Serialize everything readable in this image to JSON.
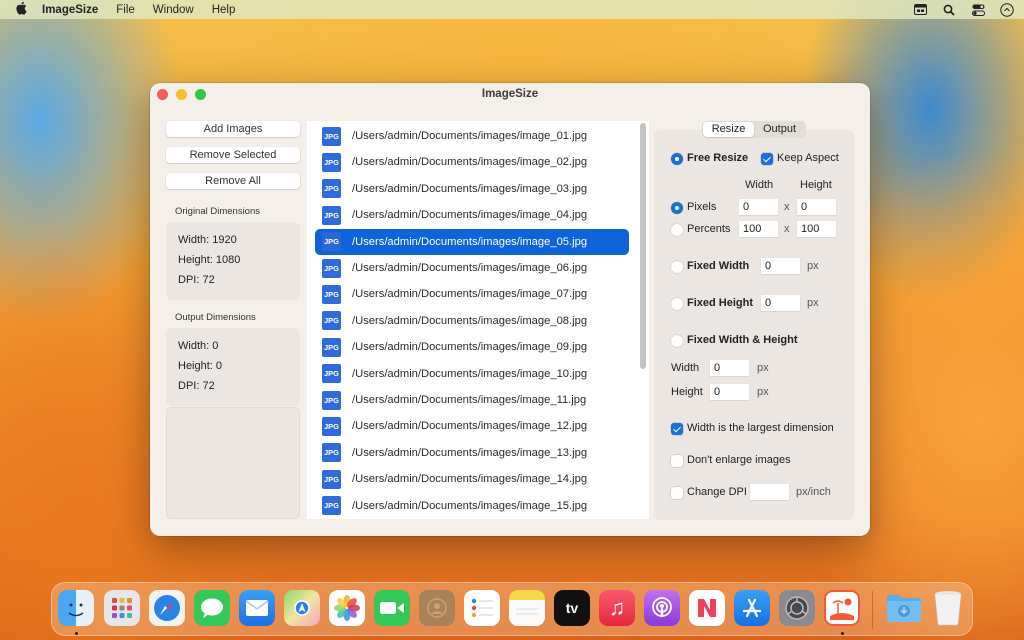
{
  "menubar": {
    "app_name": "ImageSize",
    "menus": [
      "File",
      "Window",
      "Help"
    ],
    "status_icons": [
      "keyboard-viewer-icon",
      "spotlight-search-icon",
      "control-center-icon",
      "siri-icon"
    ]
  },
  "window": {
    "title": "ImageSize"
  },
  "left_panel": {
    "buttons": {
      "add": "Add Images",
      "remove_selected": "Remove Selected",
      "remove_all": "Remove All"
    },
    "original": {
      "label": "Original Dimensions",
      "width": "Width: 1920",
      "height": "Height: 1080",
      "dpi": "DPI: 72"
    },
    "output": {
      "label": "Output Dimensions",
      "width": "Width: 0",
      "height": "Height: 0",
      "dpi": "DPI: 72"
    }
  },
  "file_list": {
    "badge": "JPG",
    "selected_index": 4,
    "items": [
      "/Users/admin/Documents/images/image_01.jpg",
      "/Users/admin/Documents/images/image_02.jpg",
      "/Users/admin/Documents/images/image_03.jpg",
      "/Users/admin/Documents/images/image_04.jpg",
      "/Users/admin/Documents/images/image_05.jpg",
      "/Users/admin/Documents/images/image_06.jpg",
      "/Users/admin/Documents/images/image_07.jpg",
      "/Users/admin/Documents/images/image_08.jpg",
      "/Users/admin/Documents/images/image_09.jpg",
      "/Users/admin/Documents/images/image_10.jpg",
      "/Users/admin/Documents/images/image_11.jpg",
      "/Users/admin/Documents/images/image_12.jpg",
      "/Users/admin/Documents/images/image_13.jpg",
      "/Users/admin/Documents/images/image_14.jpg",
      "/Users/admin/Documents/images/image_15.jpg"
    ]
  },
  "settings": {
    "tabs": [
      {
        "label": "Resize",
        "active": true
      },
      {
        "label": "Output",
        "active": false
      }
    ],
    "free_resize": {
      "label": "Free Resize",
      "selected": true
    },
    "keep_aspect": {
      "label": "Keep Aspect",
      "checked": true
    },
    "col_width": "Width",
    "col_height": "Height",
    "pixels": {
      "label": "Pixels",
      "selected": true,
      "width": "0",
      "height": "0"
    },
    "percents": {
      "label": "Percents",
      "selected": false,
      "width": "100",
      "height": "100"
    },
    "times": "x",
    "fixed_width": {
      "label": "Fixed Width",
      "selected": false,
      "value": "0",
      "unit": "px"
    },
    "fixed_height": {
      "label": "Fixed Height",
      "selected": false,
      "value": "0",
      "unit": "px"
    },
    "fixed_both": {
      "label": "Fixed Width & Height",
      "selected": false,
      "width_label": "Width",
      "width_value": "0",
      "height_label": "Height",
      "height_value": "0",
      "unit": "px"
    },
    "width_largest": {
      "label": "Width is the largest dimension",
      "checked": true
    },
    "dont_enlarge": {
      "label": "Don't enlarge images",
      "checked": false
    },
    "change_dpi": {
      "label": "Change DPI",
      "checked": false,
      "value": "",
      "unit": "px/inch"
    }
  },
  "dock": {
    "apps": [
      "Finder",
      "Launchpad",
      "Safari",
      "Messages",
      "Mail",
      "Maps",
      "Photos",
      "FaceTime",
      "Contacts",
      "Reminders",
      "Notes",
      "TV",
      "Music",
      "Podcasts",
      "News",
      "App Store",
      "System Settings",
      "ImageSize"
    ],
    "tv_label": "tv",
    "running": [
      "Finder",
      "ImageSize"
    ],
    "stacks": [
      "Downloads",
      "Trash"
    ]
  }
}
